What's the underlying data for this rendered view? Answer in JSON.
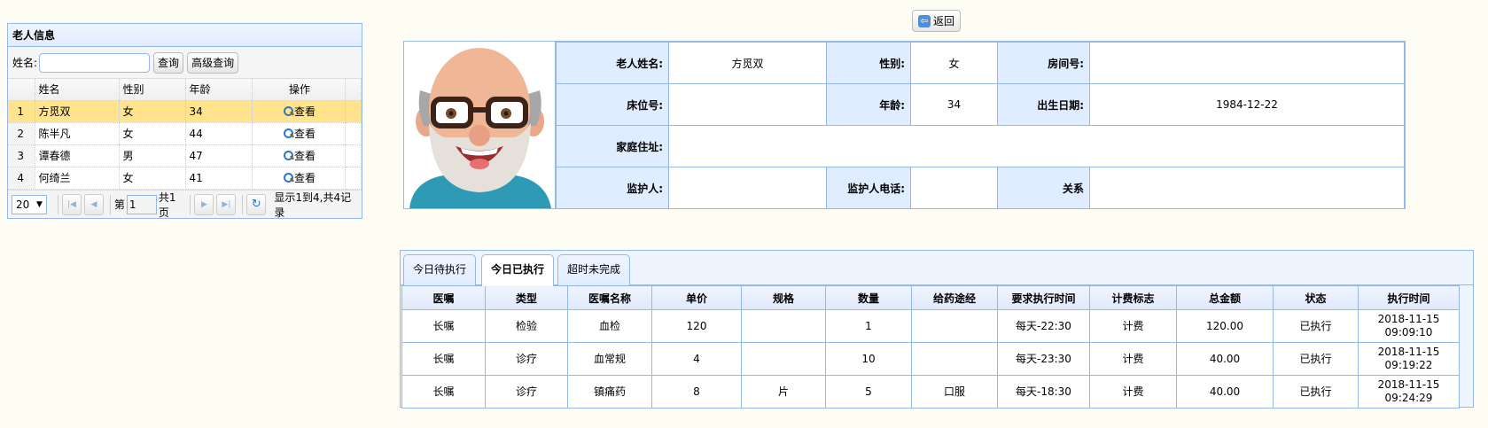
{
  "elder_panel": {
    "title": "老人信息",
    "search_label": "姓名:",
    "search_value": "",
    "search_button": "查询",
    "advanced_button": "高级查询",
    "columns": [
      "姓名",
      "性别",
      "年龄",
      "操作"
    ],
    "rows": [
      {
        "no": "1",
        "name": "方觅双",
        "gender": "女",
        "age": "34",
        "action": "查看"
      },
      {
        "no": "2",
        "name": "陈半凡",
        "gender": "女",
        "age": "44",
        "action": "查看"
      },
      {
        "no": "3",
        "name": "谭春德",
        "gender": "男",
        "age": "47",
        "action": "查看"
      },
      {
        "no": "4",
        "name": "何绮兰",
        "gender": "女",
        "age": "41",
        "action": "查看"
      }
    ],
    "pager": {
      "page_size": "20",
      "page_prefix": "第",
      "page_value": "1",
      "page_total": "共1页",
      "summary": "显示1到4,共4记录"
    }
  },
  "back_button": "返回",
  "info": {
    "name_label": "老人姓名:",
    "name_value": "方觅双",
    "gender_label": "性别:",
    "gender_value": "女",
    "room_label": "房间号:",
    "room_value": "",
    "bed_label": "床位号:",
    "bed_value": "",
    "age_label": "年龄:",
    "age_value": "34",
    "birth_label": "出生日期:",
    "birth_value": "1984-12-22",
    "address_label": "家庭住址:",
    "address_value": "",
    "guardian_label": "监护人:",
    "guardian_value": "",
    "guardian_phone_label": "监护人电话:",
    "guardian_phone_value": "",
    "relation_label": "关系",
    "relation_value": ""
  },
  "tabs": [
    "今日待执行",
    "今日已执行",
    "超时未完成"
  ],
  "orders": {
    "columns": [
      "医嘱",
      "类型",
      "医嘱名称",
      "单价",
      "规格",
      "数量",
      "给药途经",
      "要求执行时间",
      "计费标志",
      "总金额",
      "状态",
      "执行时间"
    ],
    "rows": [
      [
        "长嘱",
        "检验",
        "血检",
        "120",
        "",
        "1",
        "",
        "每天-22:30",
        "计费",
        "120.00",
        "已执行",
        "2018-11-15 09:09:10"
      ],
      [
        "长嘱",
        "诊疗",
        "血常规",
        "4",
        "",
        "10",
        "",
        "每天-23:30",
        "计费",
        "40.00",
        "已执行",
        "2018-11-15 09:19:22"
      ],
      [
        "长嘱",
        "诊疗",
        "镇痛药",
        "8",
        "片",
        "5",
        "口服",
        "每天-18:30",
        "计费",
        "40.00",
        "已执行",
        "2018-11-15 09:24:29"
      ]
    ]
  }
}
